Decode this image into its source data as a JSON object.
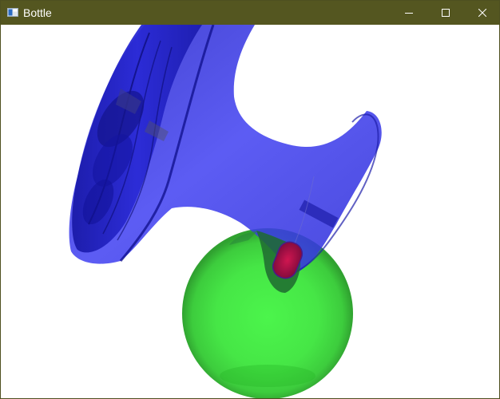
{
  "window": {
    "title": "Bottle",
    "titlebar_color": "#545620",
    "controls": [
      {
        "name": "minimize",
        "icon": "minimize-icon"
      },
      {
        "name": "maximize",
        "icon": "maximize-icon"
      },
      {
        "name": "close",
        "icon": "close-icon"
      }
    ]
  },
  "scene": {
    "background": "#ffffff",
    "objects": [
      {
        "name": "bottle",
        "color": "#3a3ae0",
        "opacity": 0.75
      },
      {
        "name": "sphere",
        "color": "#3cf03c",
        "opacity": 0.85
      },
      {
        "name": "capsule",
        "color": "#c0104a"
      }
    ]
  }
}
